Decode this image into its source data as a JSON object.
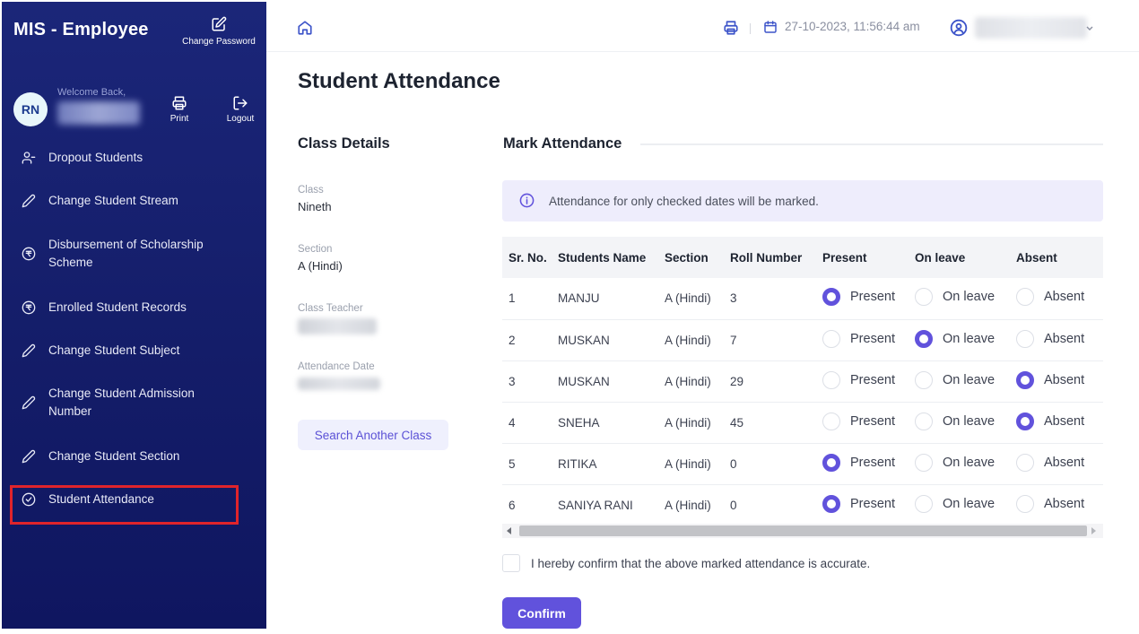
{
  "colors": {
    "sidebar_bg": "#1b2679",
    "accent": "#6152dc",
    "highlight": "#e0242b"
  },
  "sidebar": {
    "brand": "MIS - Employee",
    "change_password_label": "Change Password",
    "change_password_icon": "edit-icon",
    "avatar_initials": "RN",
    "welcome_text": "Welcome Back,",
    "print_label": "Print",
    "logout_label": "Logout",
    "items": [
      {
        "label": "Dropout Students",
        "icon": "user-minus-icon"
      },
      {
        "label": "Change Student Stream",
        "icon": "pencil-icon"
      },
      {
        "label": "Disbursement of Scholarship Scheme",
        "icon": "rupee-icon"
      },
      {
        "label": "Enrolled Student Records",
        "icon": "rupee-icon"
      },
      {
        "label": "Change Student Subject",
        "icon": "pencil-icon"
      },
      {
        "label": "Change Student Admission Number",
        "icon": "pencil-icon"
      },
      {
        "label": "Change Student Section",
        "icon": "pencil-icon"
      },
      {
        "label": "Student Attendance",
        "icon": "check-circle-icon",
        "active": true
      }
    ]
  },
  "header": {
    "datetime": "27-10-2023, 11:56:44 am"
  },
  "main": {
    "title": "Student Attendance",
    "class_details": {
      "title": "Class Details",
      "class_label": "Class",
      "class_value": "Nineth",
      "section_label": "Section",
      "section_value": "A (Hindi)",
      "teacher_label": "Class Teacher",
      "date_label": "Attendance Date",
      "search_button": "Search Another Class"
    },
    "mark_attendance": {
      "title": "Mark Attendance",
      "info": "Attendance for only checked dates will be marked.",
      "columns": [
        "Sr. No.",
        "Students Name",
        "Section",
        "Roll Number",
        "Present",
        "On leave",
        "Absent"
      ],
      "option_labels": {
        "present": "Present",
        "leave": "On leave",
        "absent": "Absent"
      },
      "rows": [
        {
          "sr": "1",
          "name": "MANJU",
          "section": "A (Hindi)",
          "roll": "3",
          "status": "present"
        },
        {
          "sr": "2",
          "name": "MUSKAN",
          "section": "A (Hindi)",
          "roll": "7",
          "status": "leave"
        },
        {
          "sr": "3",
          "name": "MUSKAN",
          "section": "A (Hindi)",
          "roll": "29",
          "status": "absent"
        },
        {
          "sr": "4",
          "name": "SNEHA",
          "section": "A (Hindi)",
          "roll": "45",
          "status": "absent"
        },
        {
          "sr": "5",
          "name": "RITIKA",
          "section": "A (Hindi)",
          "roll": "0",
          "status": "present"
        },
        {
          "sr": "6",
          "name": "SANIYA RANI",
          "section": "A (Hindi)",
          "roll": "0",
          "status": "present"
        }
      ],
      "confirm_text": "I hereby confirm that the above marked attendance is accurate.",
      "confirm_button": "Confirm"
    }
  }
}
